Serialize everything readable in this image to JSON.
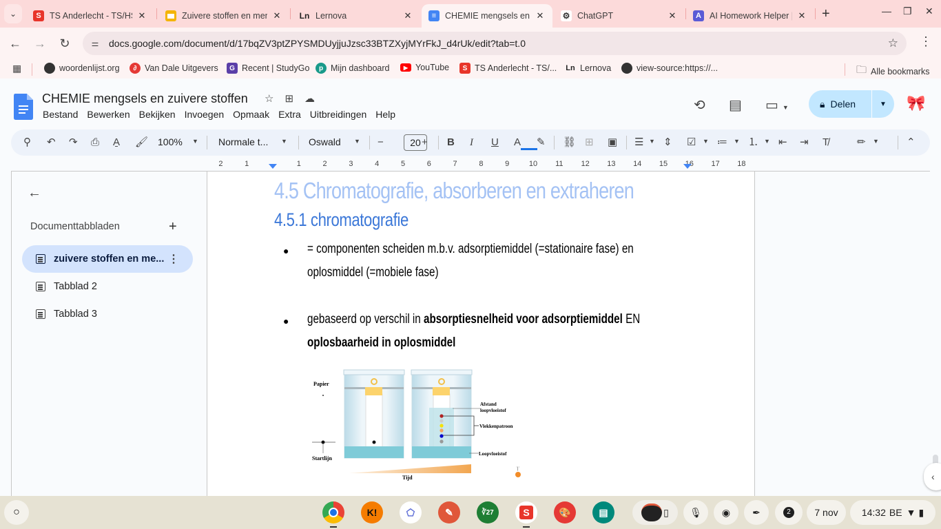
{
  "browser": {
    "tabs": [
      {
        "title": "TS Anderlecht - TS/HS",
        "favicon": "smartschool-icon",
        "favicon_color": "#e8352a",
        "favicon_glyph": "S",
        "active": false
      },
      {
        "title": "Zuivere stoffen en men",
        "favicon": "google-slides-icon",
        "favicon_color": "#f4b400",
        "favicon_glyph": "",
        "active": false
      },
      {
        "title": "Lernova",
        "favicon": "lernova-icon",
        "favicon_color": "#222222",
        "favicon_glyph": "Ln",
        "active": false
      },
      {
        "title": "CHEMIE mengsels en z",
        "favicon": "google-docs-icon",
        "favicon_color": "#4285f4",
        "favicon_glyph": "≡",
        "active": true
      },
      {
        "title": "ChatGPT",
        "favicon": "chatgpt-icon",
        "favicon_color": "#ffffff",
        "favicon_glyph": "⚙",
        "active": false
      },
      {
        "title": "AI Homework Helper |",
        "favicon": "homework-helper-icon",
        "favicon_color": "#5b5bd6",
        "favicon_glyph": "A",
        "active": false
      }
    ],
    "new_tab_label": "+",
    "url": "docs.google.com/document/d/17bqZV3ptZPYSMDUyjjuJzsc33BTZXyjMYrFkJ_d4rUk/edit?tab=t.0",
    "bookmarks": [
      {
        "label": "woordenlijst.org",
        "icon": "globe-icon",
        "color": "#333333",
        "glyph": "●"
      },
      {
        "label": "Van Dale Uitgevers",
        "icon": "vandale-icon",
        "color": "#e53935",
        "glyph": "∂"
      },
      {
        "label": "Recent | StudyGo",
        "icon": "studygo-icon",
        "color": "#5b3fa8",
        "glyph": "G"
      },
      {
        "label": "Mijn dashboard",
        "icon": "dashboard-icon",
        "color": "#1a9a8a",
        "glyph": "p"
      },
      {
        "label": "YouTube",
        "icon": "youtube-icon",
        "color": "#ff0000",
        "glyph": "▶"
      },
      {
        "label": "TS Anderlecht - TS/...",
        "icon": "smartschool-icon",
        "color": "#e8352a",
        "glyph": "S"
      },
      {
        "label": "Lernova",
        "icon": "lernova-icon",
        "color": "#222222",
        "glyph": "Ln"
      },
      {
        "label": "view-source:https://...",
        "icon": "globe-icon",
        "color": "#333333",
        "glyph": "●"
      }
    ],
    "all_bookmarks_label": "Alle bookmarks"
  },
  "docs": {
    "title": "CHEMIE mengsels en zuivere stoffen",
    "menu": [
      "Bestand",
      "Bewerken",
      "Bekijken",
      "Invoegen",
      "Opmaak",
      "Extra",
      "Uitbreidingen",
      "Help"
    ],
    "share_label": "Delen",
    "toolbar": {
      "zoom": "100%",
      "style": "Normale t...",
      "font": "Oswald",
      "font_size": "20",
      "text_color": "#1a73e8"
    },
    "ruler_labels": [
      "2",
      "1",
      "1",
      "2",
      "3",
      "4",
      "5",
      "6",
      "7",
      "8",
      "9",
      "10",
      "11",
      "12",
      "13",
      "14",
      "15",
      "16",
      "17",
      "18"
    ],
    "sidebar": {
      "heading": "Documenttabbladen",
      "tabs": [
        {
          "label": "zuivere stoffen en me...",
          "active": true
        },
        {
          "label": "Tabblad 2",
          "active": false
        },
        {
          "label": "Tabblad 3",
          "active": false
        }
      ]
    },
    "content": {
      "heading1": "4.5 Chromatografie, absorberen en extraheren",
      "heading2": "4.5.1 chromatografie",
      "bullet_char": "●",
      "bullet1_line1": "= componenten scheiden m.b.v. adsorptiemiddel (=stationaire fase) en",
      "bullet1_line2": "oplosmiddel (=mobiele fase)",
      "bullet2_line1_pre": "gebaseerd op verschil in ",
      "bullet2_line1_bold": "absorptiesnelheid voor adsorptiemiddel",
      "bullet2_line1_post": " EN",
      "bullet2_line2_bold": "oplosbaarheid in oplosmiddel",
      "heading1_color": "#a4c2f4",
      "heading2_color": "#3c78d8"
    },
    "diagram": {
      "labels": {
        "paper": "Papier",
        "startline": "Startlijn",
        "distance_line1": "Afstand",
        "distance_line2": "loopvloeistof",
        "pattern": "Vlekkenpatroon",
        "solvent": "Loopvloeistof",
        "time": "Tijd"
      },
      "spot_colors": [
        "#b22222",
        "#cccccc",
        "#f5e100",
        "#f4a460",
        "#0000cc",
        "#999999"
      ]
    }
  },
  "shelf": {
    "apps": [
      {
        "name": "chrome-app",
        "glyph": "",
        "color": "#4285f4"
      },
      {
        "name": "kahoot-app",
        "glyph": "K!",
        "color": "#f57c00"
      },
      {
        "name": "geogebra-app",
        "glyph": "⬠",
        "color": "#ffffff"
      },
      {
        "name": "sketch-app",
        "glyph": "✎",
        "color": "#e0573a"
      },
      {
        "name": "calculator-app",
        "glyph": "∛27",
        "color": "#1e7e34"
      },
      {
        "name": "smartschool-app",
        "glyph": "S",
        "color": "#e8352a"
      },
      {
        "name": "paint-app",
        "glyph": "🎨",
        "color": "#e53935"
      },
      {
        "name": "slides-app",
        "glyph": "▤",
        "color": "#00897b"
      }
    ],
    "notification_count": "2",
    "date": "7 nov",
    "time": "14:32",
    "locale": "BE"
  }
}
